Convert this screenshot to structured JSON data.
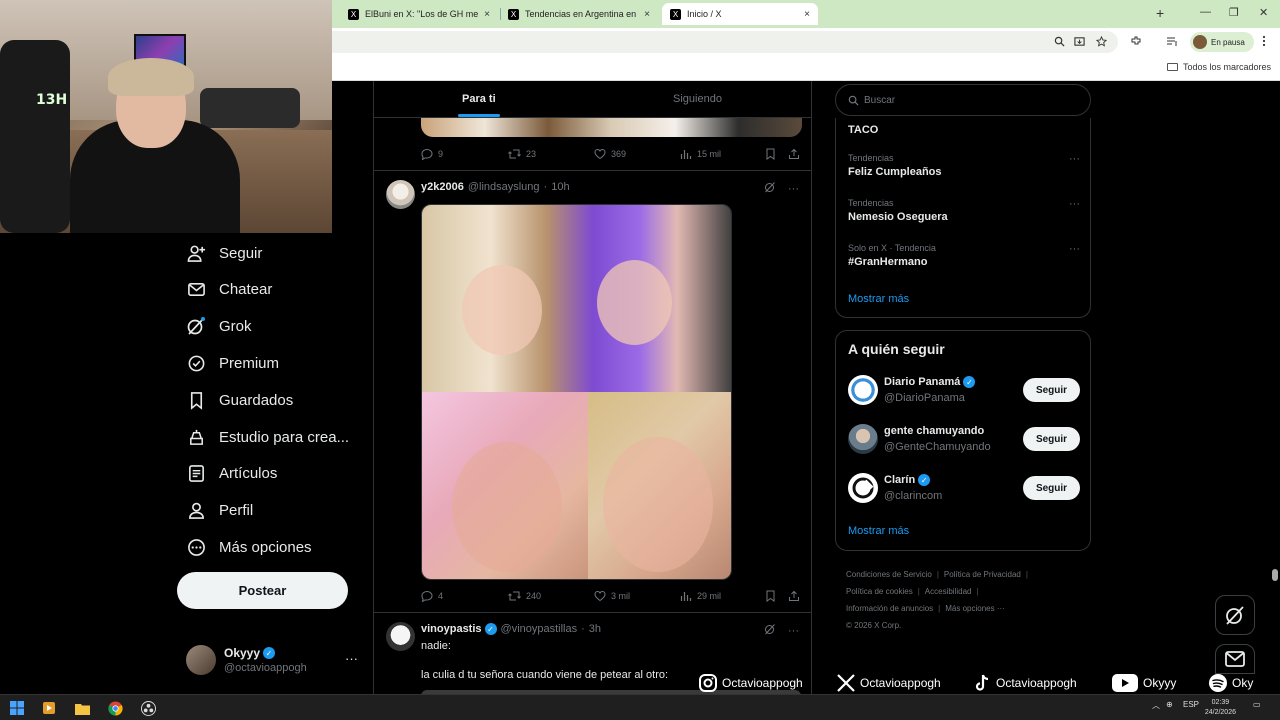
{
  "browser": {
    "tabs": [
      {
        "label": "ElBuni en X: \"Los de GH metier",
        "close": "×"
      },
      {
        "label": "Tendencias en Argentina en X: \"",
        "close": "×"
      },
      {
        "label": "Inicio / X",
        "close": "×"
      }
    ],
    "new_tab": "+",
    "profile_label": "En pausa",
    "bookmarks_all": "Todos los marcadores",
    "window_controls": [
      "—",
      "❐",
      "✕"
    ]
  },
  "webcam": {
    "neon_text": "13H"
  },
  "nav": {
    "items": [
      {
        "label": "Seguir",
        "icon": "follow-icon"
      },
      {
        "label": "Chatear",
        "icon": "mail-icon"
      },
      {
        "label": "Grok",
        "icon": "grok-icon"
      },
      {
        "label": "Premium",
        "icon": "verified-icon"
      },
      {
        "label": "Guardados",
        "icon": "bookmark-icon"
      },
      {
        "label": "Estudio para crea...",
        "icon": "creator-studio-icon"
      },
      {
        "label": "Artículos",
        "icon": "articles-icon"
      },
      {
        "label": "Perfil",
        "icon": "profile-icon"
      },
      {
        "label": "Más opciones",
        "icon": "more-options-icon"
      }
    ],
    "post_label": "Postear",
    "account": {
      "name": "Okyyy",
      "handle": "@octavioappogh",
      "more": "···"
    }
  },
  "timeline": {
    "tabs": [
      "Para ti",
      "Siguiendo"
    ],
    "prev_actions": {
      "replies": "9",
      "reposts": "23",
      "likes": "369",
      "views": "15 mil"
    },
    "tweet1": {
      "name": "y2k2006",
      "handle": "@lindsayslung",
      "time": "10h",
      "actions": {
        "replies": "4",
        "reposts": "240",
        "likes": "3 mil",
        "views": "29 mil"
      }
    },
    "tweet2": {
      "name": "vinoypastis",
      "handle": "@vinoypastillas",
      "time": "3h",
      "line1": "nadie:",
      "line2": "la culia d tu señora cuando viene de petear al otro:"
    },
    "dot": "·"
  },
  "right": {
    "search_placeholder": "Buscar",
    "trends": [
      {
        "context": "",
        "title": "TACO"
      },
      {
        "context": "Tendencias",
        "title": "Feliz Cumpleaños"
      },
      {
        "context": "Tendencias",
        "title": "Nemesio Oseguera"
      },
      {
        "context": "Solo en X · Tendencia",
        "title": "#GranHermano"
      }
    ],
    "trends_more": "Mostrar más",
    "wtf_title": "A quién seguir",
    "wtf": [
      {
        "name": "Diario Panamá",
        "handle": "@DiarioPanama",
        "button": "Seguir",
        "color": "#ffffff"
      },
      {
        "name": "gente chamuyando",
        "handle": "@GenteChamuyando",
        "button": "Seguir",
        "color": "#6a7d8c"
      },
      {
        "name": "Clarín",
        "handle": "@clarincom",
        "button": "Seguir",
        "color": "#ffffff"
      }
    ],
    "wtf_more": "Mostrar más",
    "footer": {
      "l1": "Condiciones de Servicio",
      "l2": "Política de Privacidad",
      "l3": "Política de cookies",
      "l4": "Accesibilidad",
      "l5": "Información de anuncios",
      "l6": "Más opciones ···",
      "copyright": "© 2026 X Corp."
    }
  },
  "social": [
    {
      "platform": "instagram",
      "handle": "Octavioappogh"
    },
    {
      "platform": "x",
      "handle": "Octavioappogh"
    },
    {
      "platform": "tiktok",
      "handle": "Octavioappogh"
    },
    {
      "platform": "youtube",
      "handle": "Okyyy"
    },
    {
      "platform": "spotify",
      "handle": "Oky"
    }
  ],
  "taskbar": {
    "lang": "ESP",
    "time": "02:39",
    "date": "24/2/2026"
  },
  "colors": {
    "accent": "#1d9bf0",
    "tabbar": "#cfe8c4"
  }
}
